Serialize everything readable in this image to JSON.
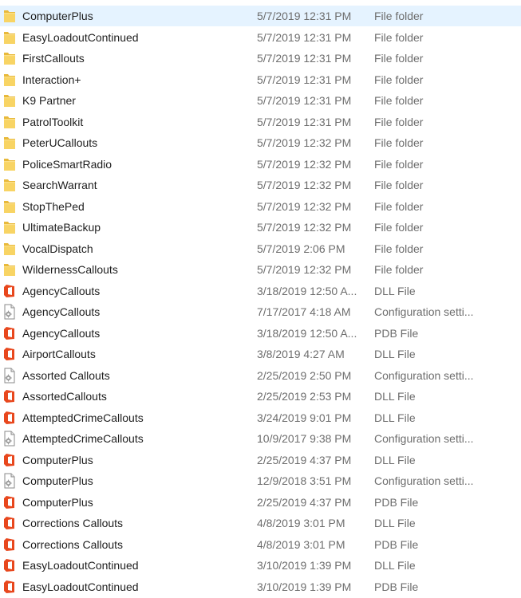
{
  "colors": {
    "selected_row_bg": "#e5f3ff",
    "folder": "#f8c94a",
    "office_orange": "#e8471d"
  },
  "files": [
    {
      "name": "ComputerPlus",
      "date": "5/7/2019 12:31 PM",
      "type": "File folder",
      "icon": "folder-icon",
      "selected": true
    },
    {
      "name": "EasyLoadoutContinued",
      "date": "5/7/2019 12:31 PM",
      "type": "File folder",
      "icon": "folder-icon"
    },
    {
      "name": "FirstCallouts",
      "date": "5/7/2019 12:31 PM",
      "type": "File folder",
      "icon": "folder-icon"
    },
    {
      "name": "Interaction+",
      "date": "5/7/2019 12:31 PM",
      "type": "File folder",
      "icon": "folder-icon"
    },
    {
      "name": "K9 Partner",
      "date": "5/7/2019 12:31 PM",
      "type": "File folder",
      "icon": "folder-icon"
    },
    {
      "name": "PatrolToolkit",
      "date": "5/7/2019 12:31 PM",
      "type": "File folder",
      "icon": "folder-icon"
    },
    {
      "name": "PeterUCallouts",
      "date": "5/7/2019 12:32 PM",
      "type": "File folder",
      "icon": "folder-icon"
    },
    {
      "name": "PoliceSmartRadio",
      "date": "5/7/2019 12:32 PM",
      "type": "File folder",
      "icon": "folder-icon"
    },
    {
      "name": "SearchWarrant",
      "date": "5/7/2019 12:32 PM",
      "type": "File folder",
      "icon": "folder-icon"
    },
    {
      "name": "StopThePed",
      "date": "5/7/2019 12:32 PM",
      "type": "File folder",
      "icon": "folder-icon"
    },
    {
      "name": "UltimateBackup",
      "date": "5/7/2019 12:32 PM",
      "type": "File folder",
      "icon": "folder-icon"
    },
    {
      "name": "VocalDispatch",
      "date": "5/7/2019 2:06 PM",
      "type": "File folder",
      "icon": "folder-icon"
    },
    {
      "name": "WildernessCallouts",
      "date": "5/7/2019 12:32 PM",
      "type": "File folder",
      "icon": "folder-icon"
    },
    {
      "name": "AgencyCallouts",
      "date": "3/18/2019 12:50 A...",
      "type": "DLL File",
      "icon": "office-file-icon"
    },
    {
      "name": "AgencyCallouts",
      "date": "7/17/2017 4:18 AM",
      "type": "Configuration setti...",
      "icon": "config-file-icon"
    },
    {
      "name": "AgencyCallouts",
      "date": "3/18/2019 12:50 A...",
      "type": "PDB File",
      "icon": "office-file-icon"
    },
    {
      "name": "AirportCallouts",
      "date": "3/8/2019 4:27 AM",
      "type": "DLL File",
      "icon": "office-file-icon"
    },
    {
      "name": "Assorted Callouts",
      "date": "2/25/2019 2:50 PM",
      "type": "Configuration setti...",
      "icon": "config-file-icon"
    },
    {
      "name": "AssortedCallouts",
      "date": "2/25/2019 2:53 PM",
      "type": "DLL File",
      "icon": "office-file-icon"
    },
    {
      "name": "AttemptedCrimeCallouts",
      "date": "3/24/2019 9:01 PM",
      "type": "DLL File",
      "icon": "office-file-icon"
    },
    {
      "name": "AttemptedCrimeCallouts",
      "date": "10/9/2017 9:38 PM",
      "type": "Configuration setti...",
      "icon": "config-file-icon"
    },
    {
      "name": "ComputerPlus",
      "date": "2/25/2019 4:37 PM",
      "type": "DLL File",
      "icon": "office-file-icon"
    },
    {
      "name": "ComputerPlus",
      "date": "12/9/2018 3:51 PM",
      "type": "Configuration setti...",
      "icon": "config-file-icon"
    },
    {
      "name": "ComputerPlus",
      "date": "2/25/2019 4:37 PM",
      "type": "PDB File",
      "icon": "office-file-icon"
    },
    {
      "name": "Corrections Callouts",
      "date": "4/8/2019 3:01 PM",
      "type": "DLL File",
      "icon": "office-file-icon"
    },
    {
      "name": "Corrections Callouts",
      "date": "4/8/2019 3:01 PM",
      "type": "PDB File",
      "icon": "office-file-icon"
    },
    {
      "name": "EasyLoadoutContinued",
      "date": "3/10/2019 1:39 PM",
      "type": "DLL File",
      "icon": "office-file-icon"
    },
    {
      "name": "EasyLoadoutContinued",
      "date": "3/10/2019 1:39 PM",
      "type": "PDB File",
      "icon": "office-file-icon"
    }
  ]
}
